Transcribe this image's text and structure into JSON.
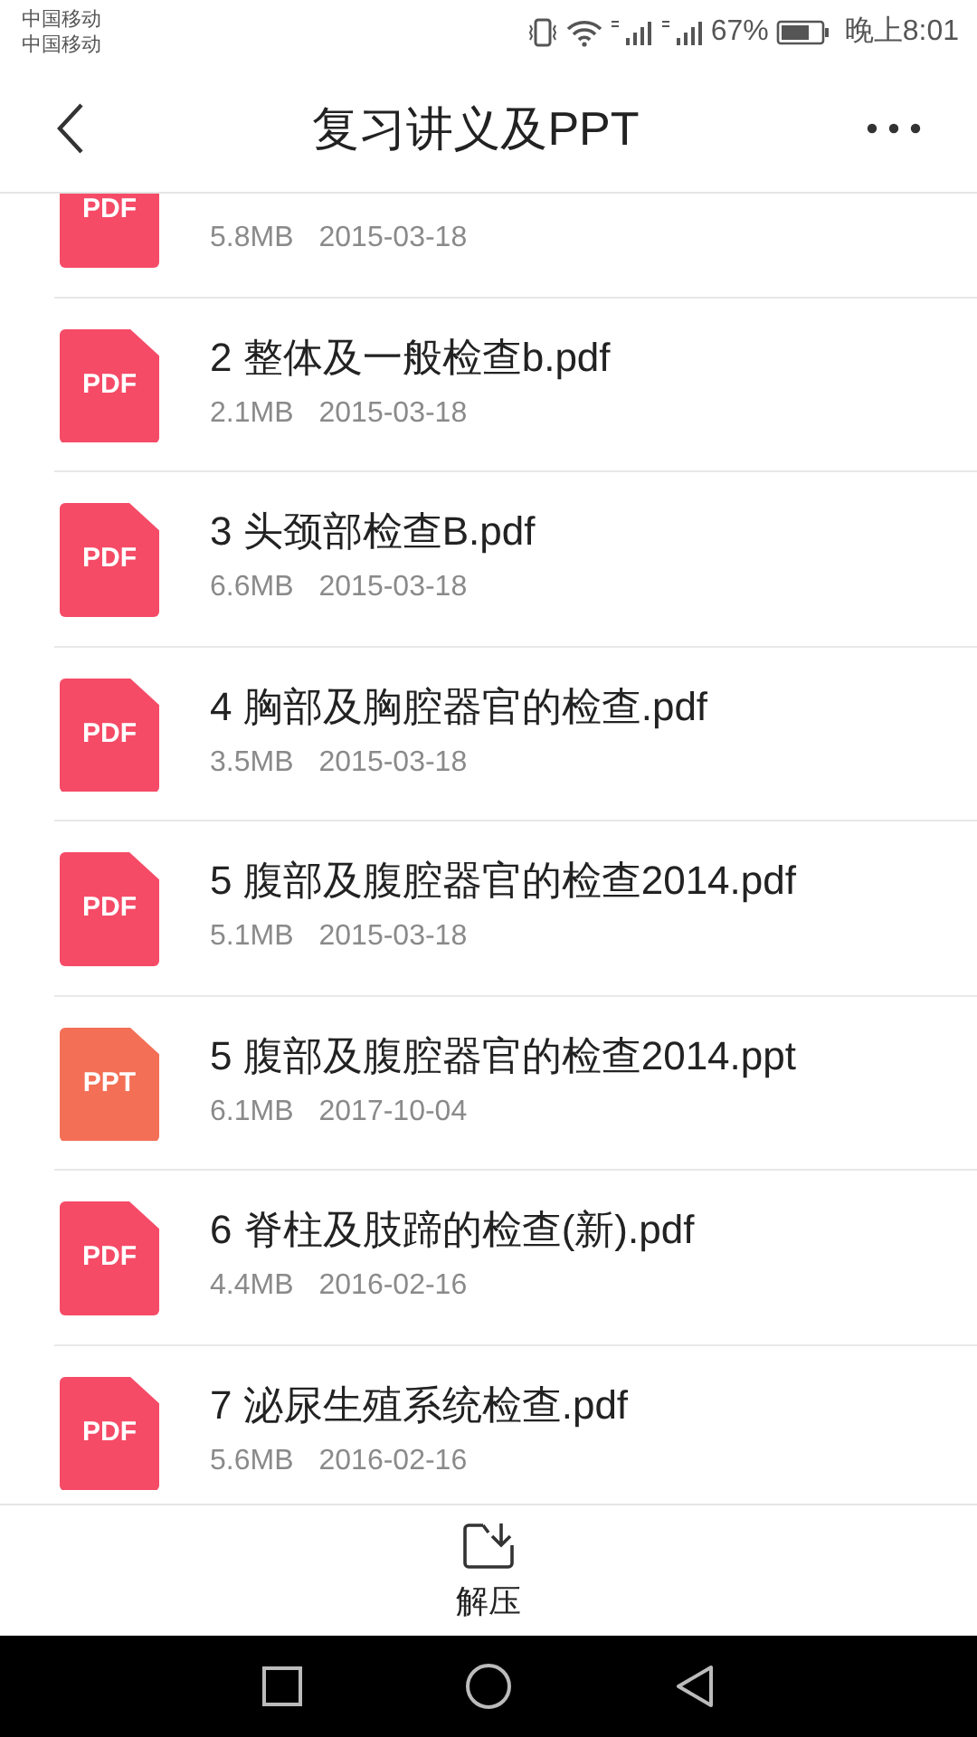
{
  "status_bar": {
    "carriers": [
      "中国移动",
      "中国移动"
    ],
    "battery": "67%",
    "time": "晚上8:01"
  },
  "header": {
    "title": "复习讲义及PPT"
  },
  "files": [
    {
      "kind": "pdf",
      "badge": "PDF",
      "size": "5.8MB",
      "date": "2015-03-18"
    },
    {
      "kind": "pdf",
      "badge": "PDF",
      "name": "2 整体及一般检查b.pdf",
      "size": "2.1MB",
      "date": "2015-03-18"
    },
    {
      "kind": "pdf",
      "badge": "PDF",
      "name": "3 头颈部检查B.pdf",
      "size": "6.6MB",
      "date": "2015-03-18"
    },
    {
      "kind": "pdf",
      "badge": "PDF",
      "name": "4 胸部及胸腔器官的检查.pdf",
      "size": "3.5MB",
      "date": "2015-03-18"
    },
    {
      "kind": "pdf",
      "badge": "PDF",
      "name": "5 腹部及腹腔器官的检查2014.pdf",
      "size": "5.1MB",
      "date": "2015-03-18"
    },
    {
      "kind": "ppt",
      "badge": "PPT",
      "name": "5 腹部及腹腔器官的检查2014.ppt",
      "size": "6.1MB",
      "date": "2017-10-04"
    },
    {
      "kind": "pdf",
      "badge": "PDF",
      "name": "6 脊柱及肢蹄的检查(新).pdf",
      "size": "4.4MB",
      "date": "2016-02-16"
    },
    {
      "kind": "pdf",
      "badge": "PDF",
      "name": "7 泌尿生殖系统检查.pdf",
      "size": "5.6MB",
      "date": "2016-02-16"
    }
  ],
  "bottom_action": {
    "label": "解压"
  }
}
